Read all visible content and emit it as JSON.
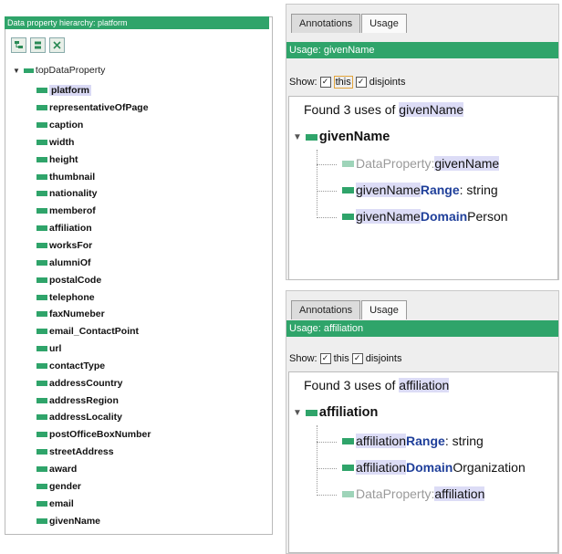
{
  "hierarchy": {
    "title": "Data property hierarchy: platform",
    "root": "topDataProperty",
    "items": [
      "platform",
      "representativeOfPage",
      "caption",
      "width",
      "height",
      "thumbnail",
      "nationality",
      "memberof",
      "affiliation",
      "worksFor",
      "alumniOf",
      "postalCode",
      "telephone",
      "faxNumeber",
      "email_ContactPoint",
      "url",
      "contactType",
      "addressCountry",
      "addressRegion",
      "addressLocality",
      "postOfficeBoxNumber",
      "streetAddress",
      "award",
      "gender",
      "email",
      "givenName"
    ],
    "toolbar": {
      "icon1": "add-subproperty-icon",
      "icon2": "add-sibling-icon",
      "icon3": "delete-icon"
    }
  },
  "panel1": {
    "tabs": [
      "Annotations",
      "Usage"
    ],
    "usage_title": "Usage: givenName",
    "show_label": "Show:",
    "this_label": "this",
    "disjoints_label": "disjoints",
    "found_prefix": "Found 3 uses of ",
    "found_name": "givenName",
    "root": "givenName",
    "items": [
      {
        "a": "DataProperty:",
        "b": " givenName"
      },
      {
        "a": "givenName ",
        "k": "Range",
        "b": ": string"
      },
      {
        "a": "givenName ",
        "k": "Domain",
        "b": " Person"
      }
    ]
  },
  "panel2": {
    "tabs": [
      "Annotations",
      "Usage"
    ],
    "usage_title": "Usage: affiliation",
    "show_label": "Show:",
    "this_label": "this",
    "disjoints_label": "disjoints",
    "found_prefix": "Found 3 uses of ",
    "found_name": "affiliation",
    "root": "affiliation",
    "items": [
      {
        "a": "affiliation ",
        "k": "Range",
        "b": ": string"
      },
      {
        "a": "affiliation ",
        "k": "Domain",
        "b": " Organization"
      },
      {
        "a": "DataProperty:",
        "b": " affiliation"
      }
    ]
  },
  "colors": {
    "accent": "#2fa46a",
    "keyword": "#1f3f9a",
    "highlight": "#dcdcf6"
  }
}
